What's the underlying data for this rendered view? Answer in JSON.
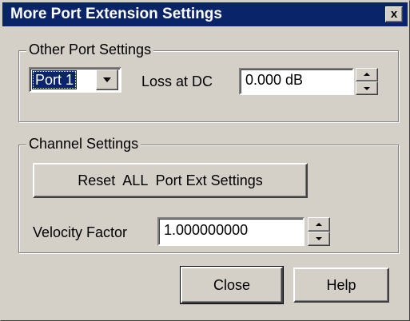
{
  "window": {
    "title": "More Port Extension Settings",
    "close_glyph": "x"
  },
  "other_port_settings": {
    "group_label": "Other Port Settings",
    "port_select": {
      "selected": "Port 1"
    },
    "loss_at_dc": {
      "label": "Loss at DC",
      "value": "0.000 dB"
    }
  },
  "channel_settings": {
    "group_label": "Channel Settings",
    "reset_button_label": "Reset  ALL  Port Ext Settings",
    "velocity_factor": {
      "label": "Velocity Factor",
      "value": "1.000000000"
    }
  },
  "footer": {
    "close_label": "Close",
    "help_label": "Help"
  },
  "icons": {
    "dropdown": "chevron-down-icon",
    "spin_up": "spin-up-icon",
    "spin_down": "spin-down-icon",
    "close": "close-icon"
  },
  "colors": {
    "titlebar": "#0a246a",
    "face": "#d4d0c8",
    "selection": "#0a246a"
  }
}
